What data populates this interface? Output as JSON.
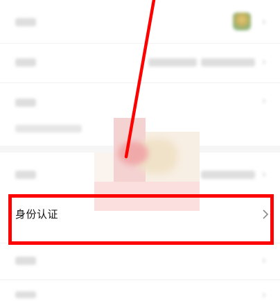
{
  "screen": {
    "identity_row": {
      "label": "身份认证",
      "chevron": "chevron-right-icon"
    },
    "annotation": {
      "highlight_color": "#ff0000",
      "arrow_color": "#ff0000"
    }
  },
  "icons": [
    "chevron-right-icon",
    "avatar-thumbnail",
    "arrow-annotation"
  ]
}
